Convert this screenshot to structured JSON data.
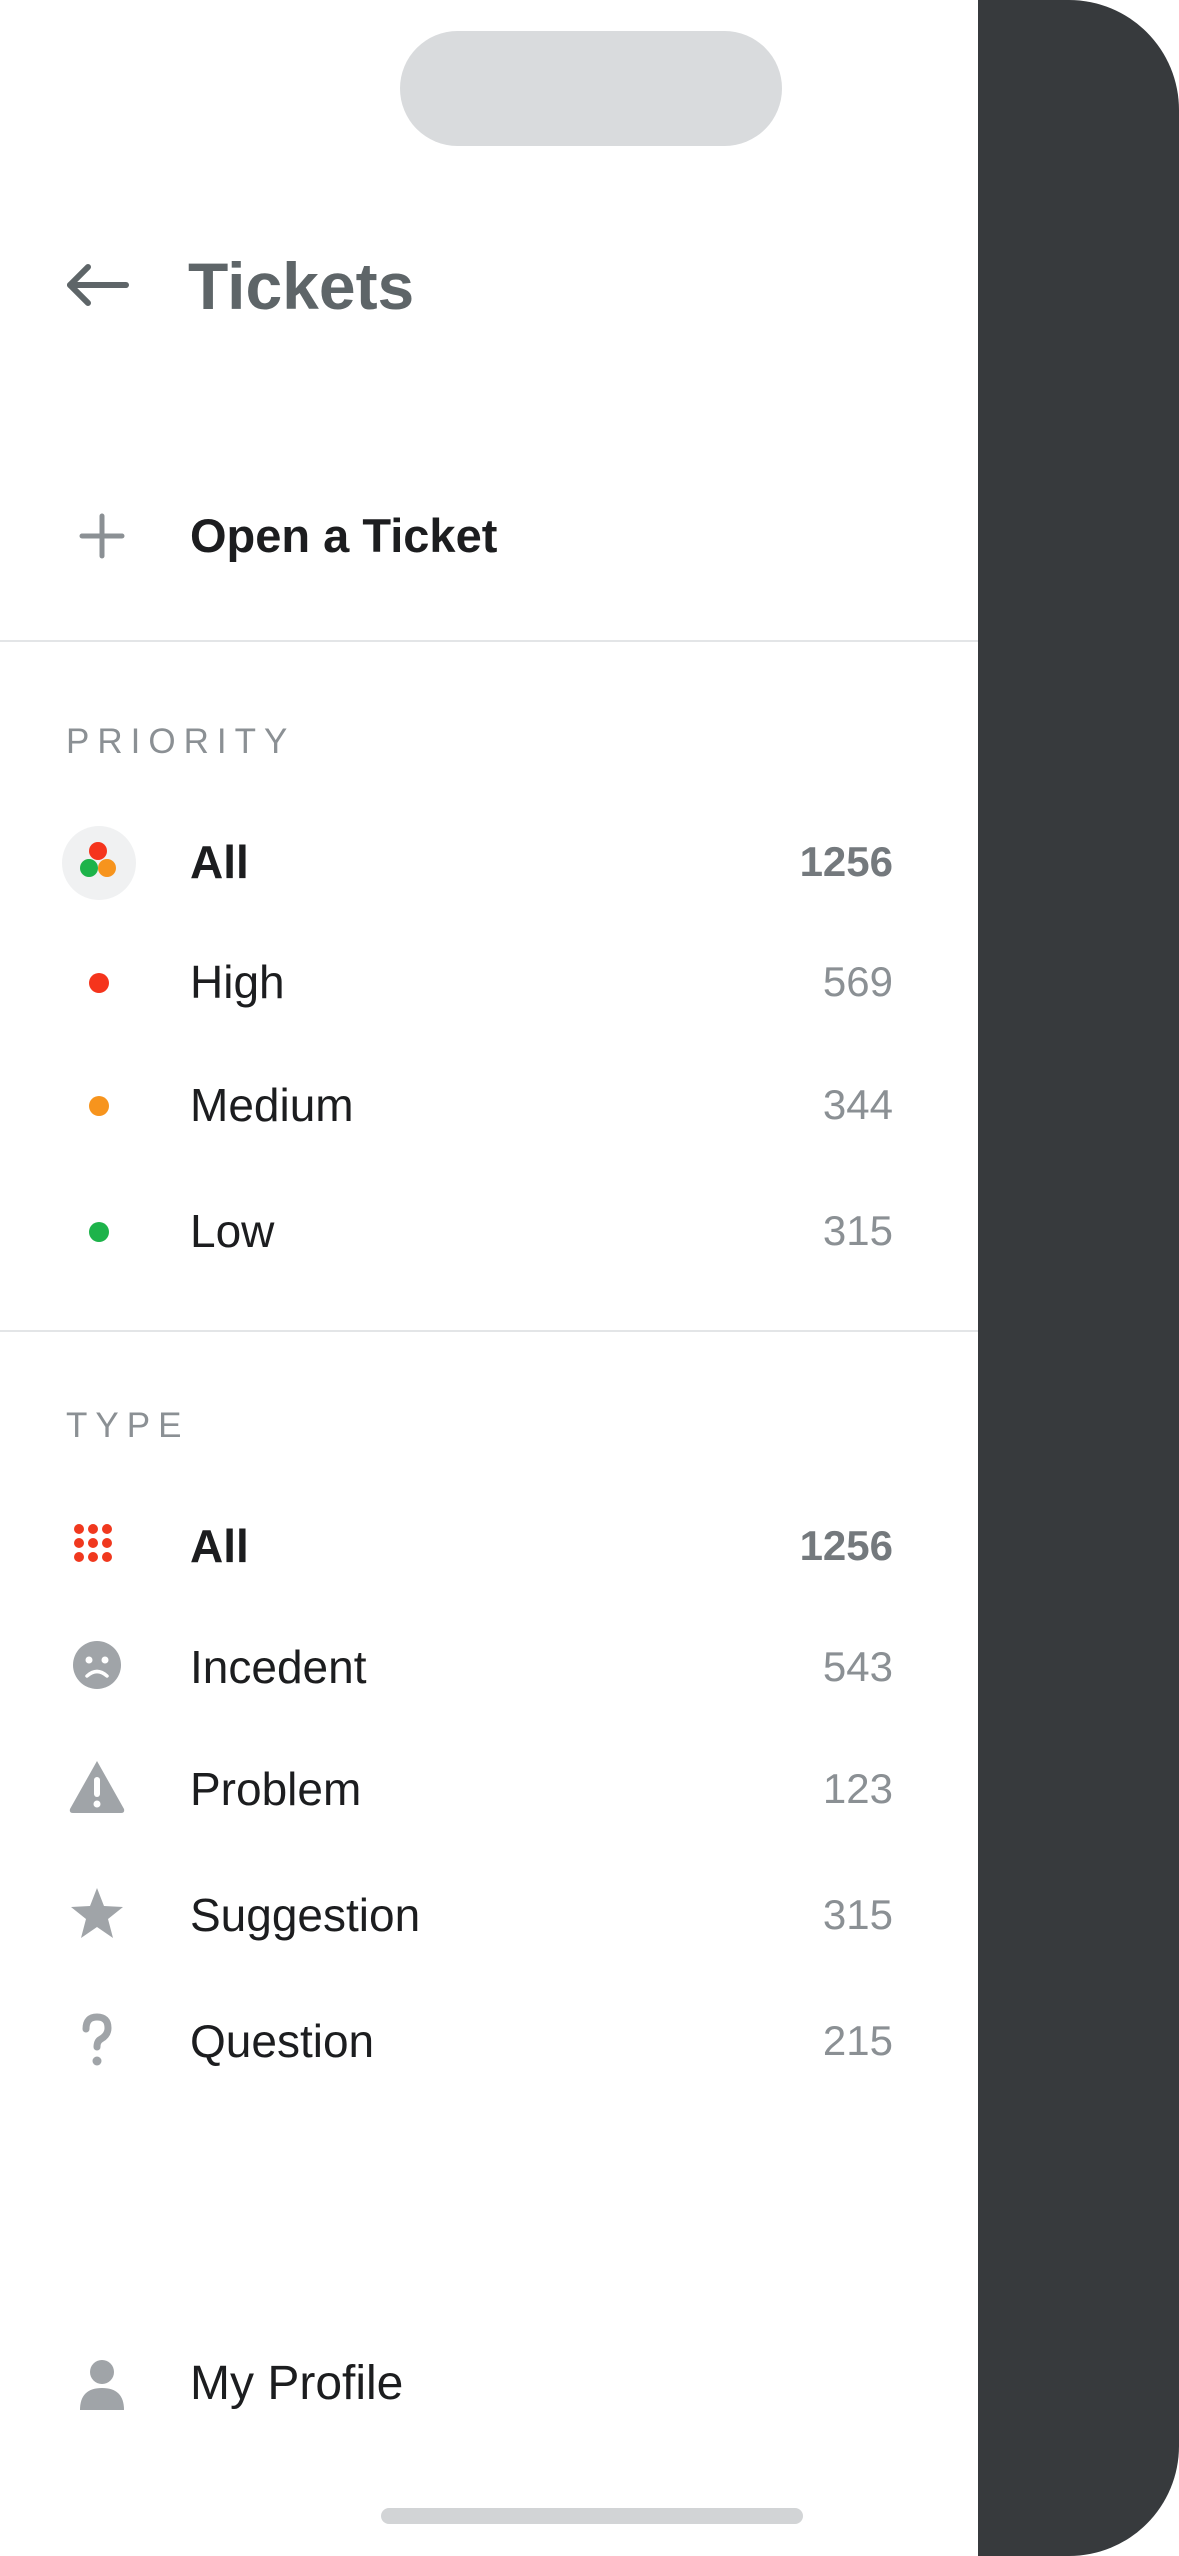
{
  "header": {
    "title": "Tickets"
  },
  "actions": {
    "open_ticket_label": "Open a Ticket"
  },
  "priority": {
    "heading": "PRIORITY",
    "items": [
      {
        "label": "All",
        "count": "1256",
        "color": "#e23b22"
      },
      {
        "label": "High",
        "count": "569",
        "color": "#f5341c"
      },
      {
        "label": "Medium",
        "count": "344",
        "color": "#f7941d"
      },
      {
        "label": "Low",
        "count": "315",
        "color": "#1db34a"
      }
    ]
  },
  "type": {
    "heading": "TYPE",
    "items": [
      {
        "label": "All",
        "count": "1256",
        "icon": "grid-dots-icon"
      },
      {
        "label": "Incedent",
        "count": "543",
        "icon": "sad-face-icon"
      },
      {
        "label": "Problem",
        "count": "123",
        "icon": "warning-icon"
      },
      {
        "label": "Suggestion",
        "count": "315",
        "icon": "star-icon"
      },
      {
        "label": "Question",
        "count": "215",
        "icon": "question-icon"
      }
    ]
  },
  "footer": {
    "profile_label": "My Profile"
  },
  "colors": {
    "accent_red": "#f0381e",
    "overlay": "#373a3d",
    "muted_icon": "#a0a4a8"
  }
}
